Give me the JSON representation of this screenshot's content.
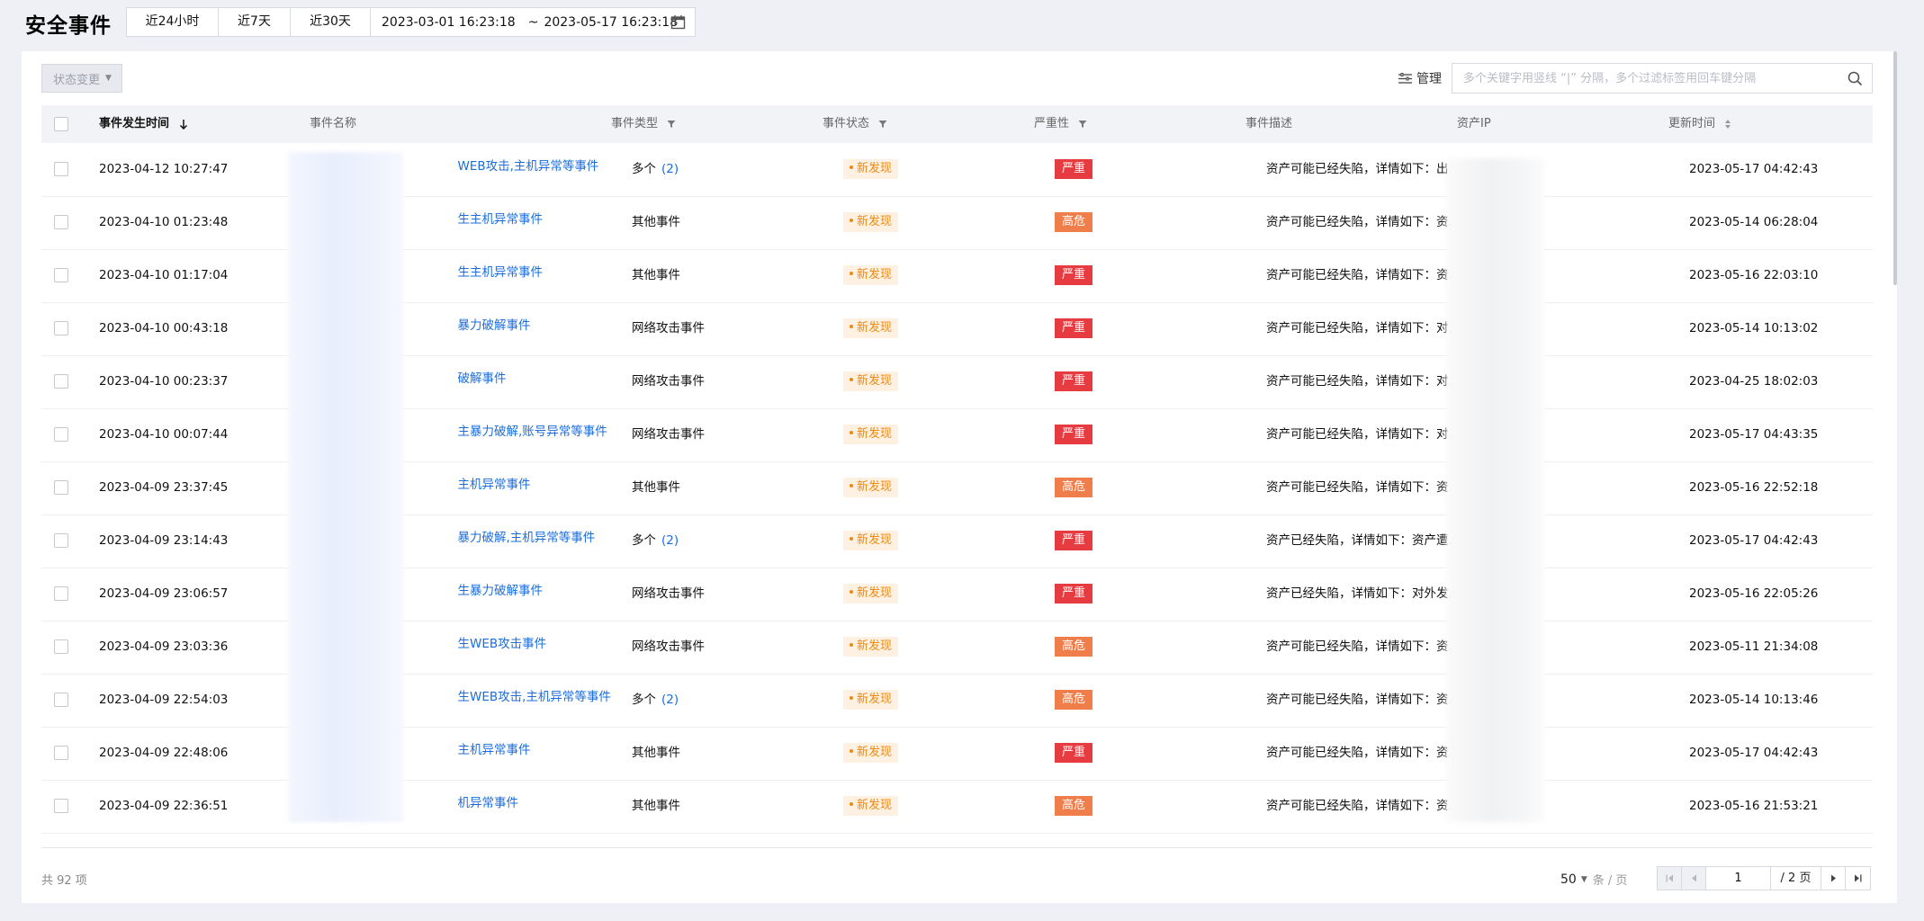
{
  "page": {
    "title": "安全事件",
    "time_ranges": [
      "近24小时",
      "近7天",
      "近30天"
    ],
    "date_range": {
      "start": "2023-03-01 16:23:18",
      "separator": "~",
      "end": "2023-05-17 16:23:18"
    }
  },
  "toolbar": {
    "status_change_label": "状态变更",
    "manage_label": "管理",
    "search_placeholder": "多个关键字用竖线 “|” 分隔，多个过滤标签用回车键分隔"
  },
  "table": {
    "columns": {
      "time": "事件发生时间",
      "name": "事件名称",
      "type": "事件类型",
      "status": "事件状态",
      "severity": "严重性",
      "desc": "事件描述",
      "ip": "资产IP",
      "updated": "更新时间"
    },
    "rows": [
      {
        "time": "2023-04-12 10:27:47",
        "name_prefix": "资",
        "name_suffix": "WEB攻击,主机异常等事件",
        "type": "多个",
        "count": "(2)",
        "status": "新发现",
        "severity": "严重",
        "severity_color": "#e63b41",
        "desc": "资产可能已经失陷，详情如下：出…",
        "updated": "2023-05-17 04:42:43"
      },
      {
        "time": "2023-04-10 01:23:48",
        "name_prefix": "资",
        "name_suffix": "生主机异常事件",
        "type": "其他事件",
        "count": "",
        "status": "新发现",
        "severity": "高危",
        "severity_color": "#f07e4b",
        "desc": "资产可能已经失陷，详情如下：资…",
        "updated": "2023-05-14 06:28:04"
      },
      {
        "time": "2023-04-10 01:17:04",
        "name_prefix": "资",
        "name_suffix": "生主机异常事件",
        "type": "其他事件",
        "count": "",
        "status": "新发现",
        "severity": "严重",
        "severity_color": "#e63b41",
        "desc": "资产可能已经失陷，详情如下：资…",
        "updated": "2023-05-16 22:03:10"
      },
      {
        "time": "2023-04-10 00:43:18",
        "name_prefix": "资",
        "name_suffix": "暴力破解事件",
        "type": "网络攻击事件",
        "count": "",
        "status": "新发现",
        "severity": "严重",
        "severity_color": "#e63b41",
        "desc": "资产可能已经失陷，详情如下：对…",
        "updated": "2023-05-14 10:13:02"
      },
      {
        "time": "2023-04-10 00:23:37",
        "name_prefix": "资",
        "name_suffix": "破解事件",
        "type": "网络攻击事件",
        "count": "",
        "status": "新发现",
        "severity": "严重",
        "severity_color": "#e63b41",
        "desc": "资产可能已经失陷，详情如下：对…",
        "updated": "2023-04-25 18:02:03"
      },
      {
        "time": "2023-04-10 00:07:44",
        "name_prefix": "资",
        "name_suffix": "主暴力破解,账号异常等事件",
        "type": "网络攻击事件",
        "count": "",
        "status": "新发现",
        "severity": "严重",
        "severity_color": "#e63b41",
        "desc": "资产可能已经失陷，详情如下：对…",
        "updated": "2023-05-17 04:43:35"
      },
      {
        "time": "2023-04-09 23:37:45",
        "name_prefix": "资",
        "name_suffix": "主机异常事件",
        "type": "其他事件",
        "count": "",
        "status": "新发现",
        "severity": "高危",
        "severity_color": "#f07e4b",
        "desc": "资产可能已经失陷，详情如下：资…",
        "updated": "2023-05-16 22:52:18"
      },
      {
        "time": "2023-04-09 23:14:43",
        "name_prefix": "资",
        "name_suffix": "暴力破解,主机异常等事件",
        "type": "多个",
        "count": "(2)",
        "status": "新发现",
        "severity": "严重",
        "severity_color": "#e63b41",
        "desc": "资产已经失陷，详情如下：资产遭…",
        "updated": "2023-05-17 04:42:43"
      },
      {
        "time": "2023-04-09 23:06:57",
        "name_prefix": "资",
        "name_suffix": "生暴力破解事件",
        "type": "网络攻击事件",
        "count": "",
        "status": "新发现",
        "severity": "严重",
        "severity_color": "#e63b41",
        "desc": "资产已经失陷，详情如下：对外发…",
        "updated": "2023-05-16 22:05:26"
      },
      {
        "time": "2023-04-09 23:03:36",
        "name_prefix": "资",
        "name_suffix": "生WEB攻击事件",
        "type": "网络攻击事件",
        "count": "",
        "status": "新发现",
        "severity": "高危",
        "severity_color": "#f07e4b",
        "desc": "资产可能已经失陷，详情如下：资…",
        "updated": "2023-05-11 21:34:08"
      },
      {
        "time": "2023-04-09 22:54:03",
        "name_prefix": "资",
        "name_suffix": "生WEB攻击,主机异常等事件",
        "type": "多个",
        "count": "(2)",
        "status": "新发现",
        "severity": "高危",
        "severity_color": "#f07e4b",
        "desc": "资产可能已经失陷，详情如下：资…",
        "updated": "2023-05-14 10:13:46"
      },
      {
        "time": "2023-04-09 22:48:06",
        "name_prefix": "资",
        "name_suffix": "主机异常事件",
        "type": "其他事件",
        "count": "",
        "status": "新发现",
        "severity": "严重",
        "severity_color": "#e63b41",
        "desc": "资产可能已经失陷，详情如下：资…",
        "updated": "2023-05-17 04:42:43"
      },
      {
        "time": "2023-04-09 22:36:51",
        "name_prefix": "资",
        "name_suffix": "机异常事件",
        "type": "其他事件",
        "count": "",
        "status": "新发现",
        "severity": "高危",
        "severity_color": "#f07e4b",
        "desc": "资产可能已经失陷，详情如下：资…",
        "updated": "2023-05-16 21:53:21"
      }
    ]
  },
  "footer": {
    "total": "共 92 项",
    "page_size": "50",
    "page_size_unit": "条 / 页",
    "current_page": "1",
    "total_pages": "/ 2 页"
  },
  "colors": {
    "link": "#1a6ddb",
    "status_new_bg": "#fef1e1",
    "status_new_text": "#ee8a13",
    "severity_critical": "#e63b41",
    "severity_high": "#f07e4b"
  }
}
